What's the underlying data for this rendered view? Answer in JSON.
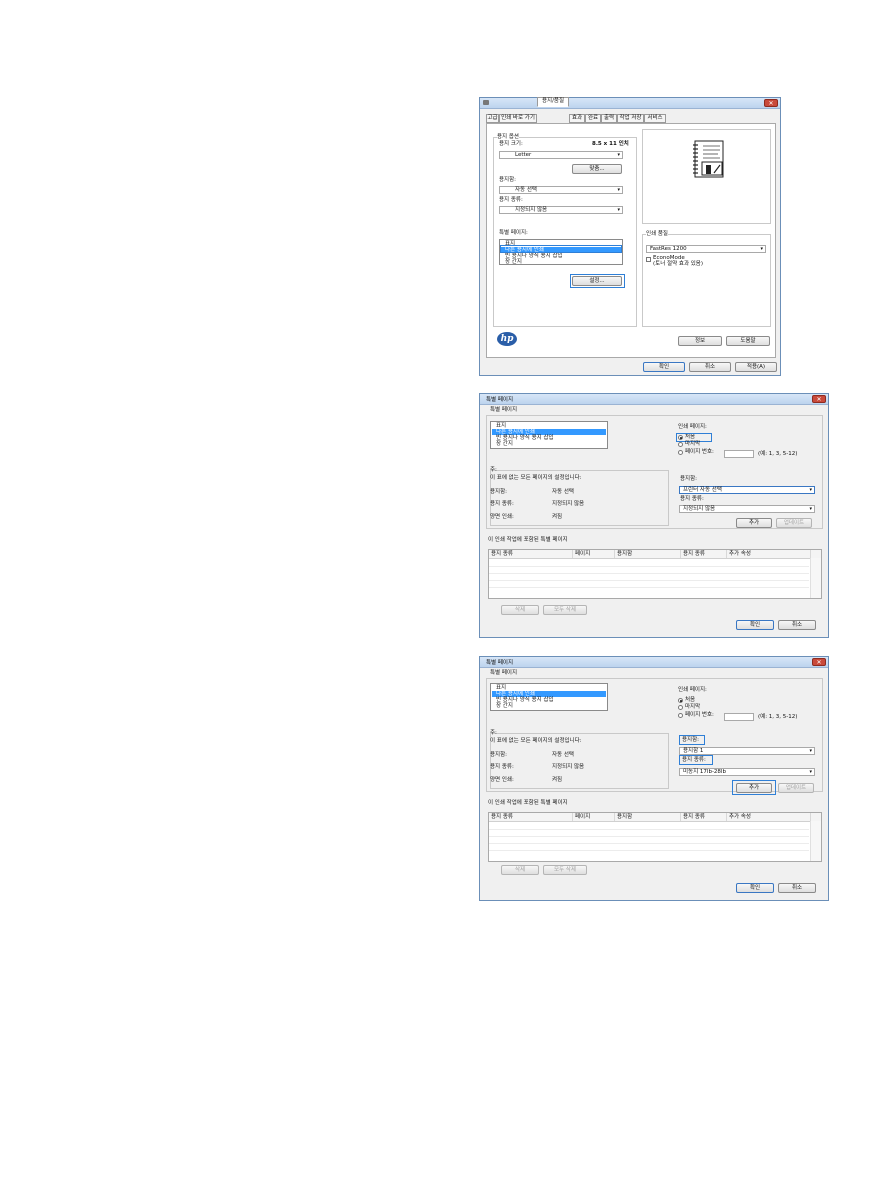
{
  "dialog1": {
    "title_icon": "printer-icon",
    "tabs": [
      "고급",
      "인쇄 바로 가기",
      "용지/품질",
      "효과",
      "완료",
      "출력",
      "작업 저장",
      "서비스"
    ],
    "active_tab": "용지/품질",
    "paper_options_title": "용지 옵션",
    "paper_size_label": "용지 크기:",
    "paper_size_value": "8.5 x 11 인치",
    "paper_size_select": "Letter",
    "custom_button": "맞춤...",
    "paper_source_label": "용지함:",
    "paper_source_select": "자동 선택",
    "paper_type_label": "용지 종류:",
    "paper_type_select": "지정되지 않음",
    "special_pages_label": "특별 페이지:",
    "special_pages_items": [
      "표지",
      "다른 용지에 인쇄",
      "빈 용지나 양식 용지 삽입",
      "장 간지"
    ],
    "special_pages_selected_index": 1,
    "settings_button": "설정...",
    "print_quality_label": "인쇄 품질",
    "print_quality_select": "FastRes 1200",
    "economode_label_1": "EconoMode",
    "economode_label_2": "(토너 절약 효과 있음)",
    "about_button": "정보",
    "help_button": "도움말",
    "ok_button": "확인",
    "cancel_button": "취소",
    "apply_button": "적용(A)"
  },
  "dialog2": {
    "title": "특별 페이지",
    "group_title": "특별 페이지",
    "list_items": [
      "표지",
      "다른 용지에 인쇄",
      "빈 용지나 양식 용지 삽입",
      "장 간지"
    ],
    "list_selected_index": 1,
    "print_pages_label": "인쇄 페이지:",
    "radio_first": "처음",
    "radio_last": "마지막",
    "radio_page_numbers": "페이지 번호:",
    "page_example": "(예: 1, 3, 5-12)",
    "note_label": "주:",
    "note_text": "이 표에 없는 모든 페이지의 설정입니다:",
    "source_label": "용지함:",
    "source_value": "자동 선택",
    "type_label": "용지 종류:",
    "type_value": "지정되지 않음",
    "duplex_label": "양면 인쇄:",
    "duplex_value": "켜짐",
    "paper_source_label": "용지함:",
    "paper_source_select": "프린터 자동 선택",
    "paper_type_label": "용지 종류:",
    "paper_type_select": "지정되지 않음",
    "add_button": "추가",
    "update_button": "업데이트",
    "table_title": "이 인쇄 작업에 포함된 특별 페이지",
    "columns": [
      "용지 종류",
      "페이지",
      "용지함",
      "용지 종류",
      "추가 속성"
    ],
    "delete_button": "삭제",
    "delete_all_button": "모두 삭제",
    "ok_button": "확인",
    "cancel_button": "취소"
  },
  "dialog3": {
    "title": "특별 페이지",
    "group_title": "특별 페이지",
    "list_items": [
      "표지",
      "다른 용지에 인쇄",
      "빈 용지나 양식 용지 삽입",
      "장 간지"
    ],
    "list_selected_index": 1,
    "print_pages_label": "인쇄 페이지:",
    "radio_first": "처음",
    "radio_last": "마지막",
    "radio_page_numbers": "페이지 번호:",
    "page_example": "(예: 1, 3, 5-12)",
    "note_label": "주:",
    "note_text": "이 표에 없는 모든 페이지의 설정입니다:",
    "source_label": "용지함:",
    "source_value": "자동 선택",
    "type_label": "용지 종류:",
    "type_value": "지정되지 않음",
    "duplex_label": "양면 인쇄:",
    "duplex_value": "켜짐",
    "paper_source_label": "용지함:",
    "paper_source_select": "용지함 1",
    "paper_type_label": "용지 종류:",
    "paper_type_select": "미농지 17lb-28lb",
    "add_button": "추가",
    "update_button": "업데이트",
    "table_title": "이 인쇄 작업에 포함된 특별 페이지",
    "columns": [
      "용지 종류",
      "페이지",
      "용지함",
      "용지 종류",
      "추가 속성"
    ],
    "delete_button": "삭제",
    "delete_all_button": "모두 삭제",
    "ok_button": "확인",
    "cancel_button": "취소"
  },
  "colors": {
    "highlight": "#2f7fd6",
    "selection": "#3399ff",
    "close": "#c94a3b"
  }
}
